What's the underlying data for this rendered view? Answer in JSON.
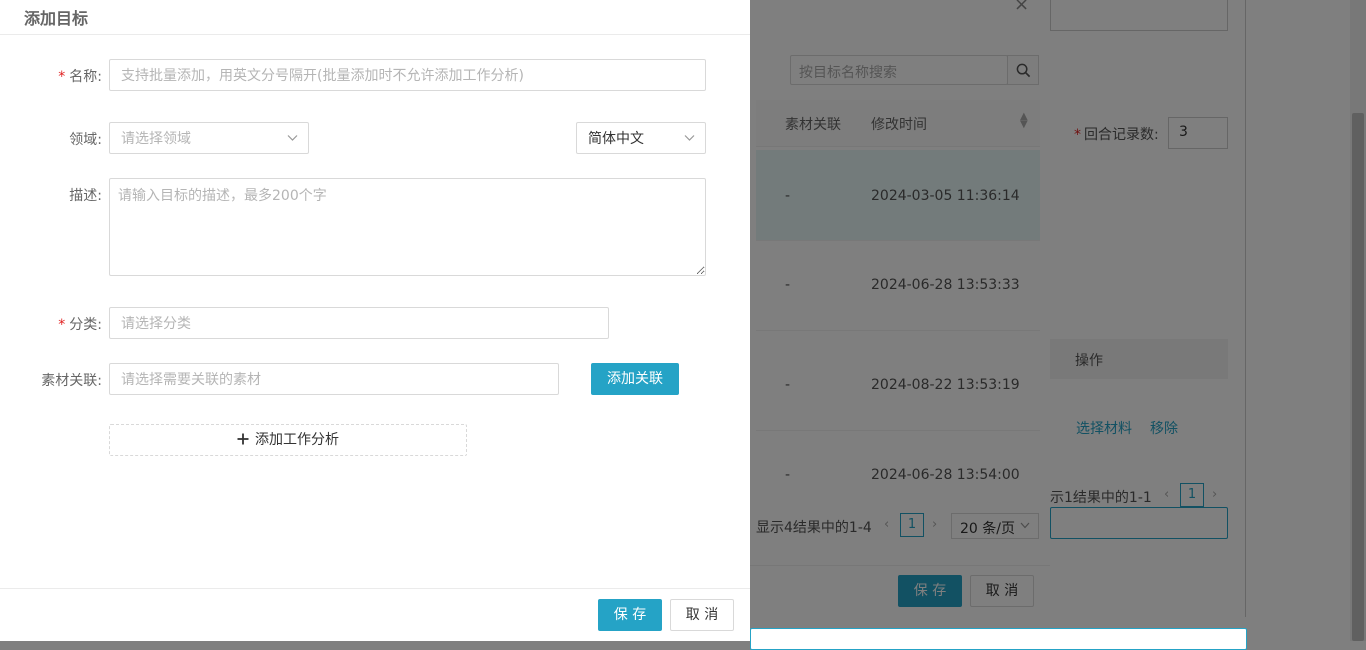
{
  "drawer": {
    "title": "添加目标",
    "fields": {
      "name": {
        "label": "名称:",
        "placeholder": "支持批量添加，用英文分号隔开(批量添加时不允许添加工作分析)"
      },
      "domain": {
        "label": "领域:",
        "placeholder": "请选择领域"
      },
      "language": {
        "value": "简体中文"
      },
      "description": {
        "label": "描述:",
        "placeholder": "请输入目标的描述，最多200个字"
      },
      "category": {
        "label": "分类:",
        "placeholder": "请选择分类"
      },
      "material": {
        "label": "素材关联:",
        "placeholder": "请选择需要关联的素材",
        "button": "添加关联"
      }
    },
    "add_analysis": "添加工作分析",
    "save": "保 存",
    "cancel": "取 消"
  },
  "background_modal": {
    "search_placeholder": "按目标名称搜索",
    "columns": [
      "素材关联",
      "修改时间"
    ],
    "rows": [
      {
        "material": "-",
        "time": "2024-03-05 11:36:14"
      },
      {
        "material": "-",
        "time": "2024-06-28 13:53:33"
      },
      {
        "material": "-",
        "time": "2024-08-22 13:53:19"
      },
      {
        "material": "-",
        "time": "2024-06-28 13:54:00"
      }
    ],
    "pager_text": "显示4结果中的1-4",
    "current_page": "1",
    "page_size": "20 条/页",
    "save": "保 存",
    "cancel": "取 消"
  },
  "background_page": {
    "rounds_label": "回合记录数:",
    "rounds_value": "3",
    "ops_header": "操作",
    "link_select": "选择材料",
    "link_remove": "移除",
    "pager_text": "示1结果中的1-1",
    "current_page": "1"
  },
  "colors": {
    "primary": "#25a3c6",
    "required": "#e02020",
    "active_row": "#e6f7f7"
  }
}
